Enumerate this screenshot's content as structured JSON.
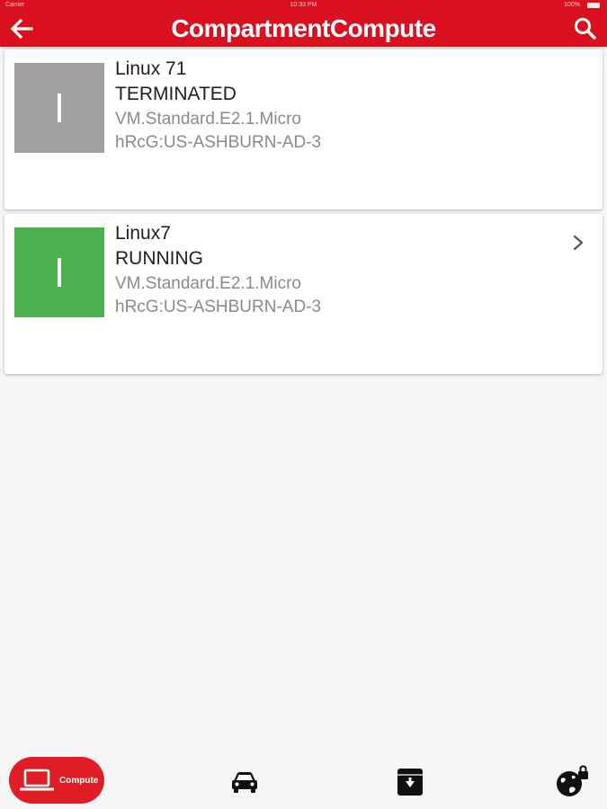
{
  "status_bar": {
    "carrier": "Carrier",
    "time": "10:33 PM",
    "battery": "100%"
  },
  "header": {
    "title": "CompartmentCompute",
    "back_icon": "arrow-left-icon",
    "search_icon": "search-icon"
  },
  "instances": [
    {
      "name": "Linux 71",
      "state": "TERMINATED",
      "shape": "VM.Standard.E2.1.Micro",
      "availability_domain": "hRcG:US-ASHBURN-AD-3",
      "color": "#a0a0a0",
      "chevron": false
    },
    {
      "name": "Linux7",
      "state": "RUNNING",
      "shape": "VM.Standard.E2.1.Micro",
      "availability_domain": "hRcG:US-ASHBURN-AD-3",
      "color": "#4caf50",
      "chevron": true
    }
  ],
  "bottom_nav": {
    "active_label": "Compute",
    "items": [
      {
        "icon": "laptop-icon"
      },
      {
        "icon": "car-icon"
      },
      {
        "icon": "archive-download-icon"
      },
      {
        "icon": "globe-lock-icon"
      }
    ]
  },
  "colors": {
    "brand_red": "#d81020",
    "nav_active_red": "#e01d25"
  }
}
